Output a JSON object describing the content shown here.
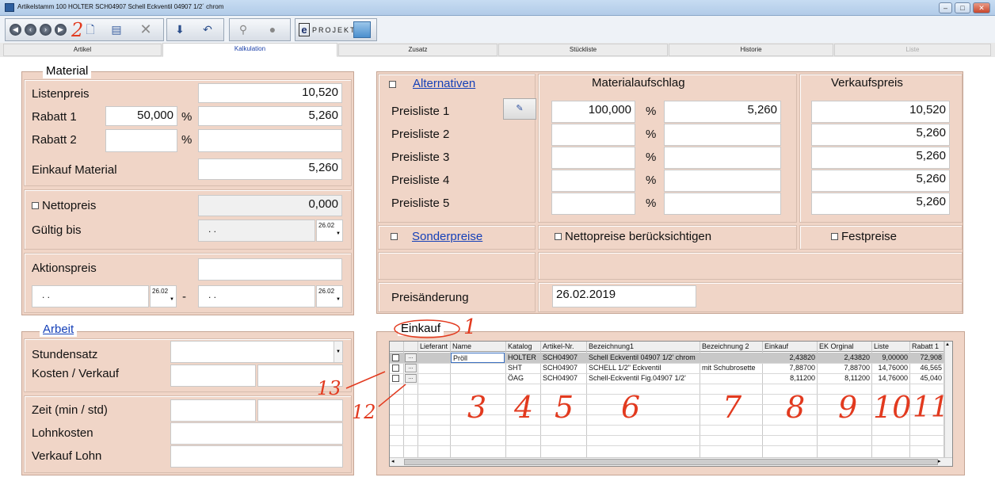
{
  "window": {
    "title": "Artikelstamm 100 HOLTER    SCH04907  Schell Eckventil 04907 1/2´ chrom"
  },
  "toolbar": {
    "project_label": "PROJEKT:",
    "project_prefix": "e"
  },
  "tabs": [
    "Artikel",
    "Kalkulation",
    "Zusatz",
    "Stückliste",
    "Historie",
    "Liste"
  ],
  "material": {
    "title": "Material",
    "listenpreis_label": "Listenpreis",
    "listenpreis": "10,520",
    "rabatt1_label": "Rabatt 1",
    "rabatt1_pct": "50,000",
    "rabatt1_value": "5,260",
    "rabatt2_label": "Rabatt 2",
    "percent": "%",
    "einkauf_label": "Einkauf Material",
    "einkauf": "5,260",
    "nettopreis_label": "Nettopreis",
    "nettopreis": "0,000",
    "gueltig_label": "Gültig bis",
    "gueltig_date": ". .",
    "date_btn": "26.02",
    "aktionspreis_label": "Aktionspreis",
    "aktion_from": ". .",
    "aktion_to": ". .",
    "dash": "-"
  },
  "arbeit": {
    "title": "Arbeit",
    "stundensatz_label": "Stundensatz",
    "kosten_label": "Kosten / Verkauf",
    "zeit_label": "Zeit  (min / std)",
    "lohnkosten_label": "Lohnkosten",
    "verkauf_lohn_label": "Verkauf Lohn"
  },
  "preise": {
    "alternativen_label": "Alternativen",
    "materialaufschlag_label": "Materialaufschlag",
    "verkaufspreis_label": "Verkaufspreis",
    "rows": [
      {
        "label": "Preisliste 1",
        "pct": "100,000",
        "value": "5,260",
        "vk": "10,520"
      },
      {
        "label": "Preisliste 2",
        "pct": "",
        "value": "",
        "vk": "5,260"
      },
      {
        "label": "Preisliste 3",
        "pct": "",
        "value": "",
        "vk": "5,260"
      },
      {
        "label": "Preisliste 4",
        "pct": "",
        "value": "",
        "vk": "5,260"
      },
      {
        "label": "Preisliste 5",
        "pct": "",
        "value": "",
        "vk": "5,260"
      }
    ],
    "sonderpreise_label": "Sonderpreise",
    "nettopreise_label": "Nettopreise berücksichtigen",
    "festpreise_label": "Festpreise",
    "preisaenderung_label": "Preisänderung",
    "preisaenderung": "26.02.2019"
  },
  "einkauf": {
    "title": "Einkauf",
    "columns": [
      "Lieferant",
      "Name",
      "Katalog",
      "Artikel-Nr.",
      "Bezeichnung1",
      "Bezeichnung 2",
      "Einkauf",
      "EK Orginal",
      "Liste",
      "Rabatt 1"
    ],
    "rows": [
      {
        "name": "Pröll",
        "katalog": "HOLTER",
        "artnr": "SCH04907",
        "bez1": "Schell Eckventil 04907 1/2' chrom",
        "bez2": "",
        "einkauf": "2,43820",
        "ek": "2,43820",
        "liste": "9,00000",
        "rabatt": "72,908"
      },
      {
        "name": "",
        "katalog": "SHT",
        "artnr": "SCH04907",
        "bez1": "SCHELL 1/2\" Eckventil",
        "bez2": "mit Schubrosette",
        "einkauf": "7,88700",
        "ek": "7,88700",
        "liste": "14,76000",
        "rabatt": "46,565"
      },
      {
        "name": "",
        "katalog": "ÖAG",
        "artnr": "SCH04907",
        "bez1": "Schell-Eckventil Fig.04907  1/2'",
        "bez2": "",
        "einkauf": "8,11200",
        "ek": "8,11200",
        "liste": "14,76000",
        "rabatt": "45,040"
      }
    ],
    "btn": "..."
  },
  "annotations": {
    "n1": "1",
    "n2": "2",
    "n3": "3",
    "n4": "4",
    "n5": "5",
    "n6": "6",
    "n7": "7",
    "n8": "8",
    "n9": "9",
    "n10": "10",
    "n11": "11",
    "n12": "12",
    "n13": "13"
  }
}
